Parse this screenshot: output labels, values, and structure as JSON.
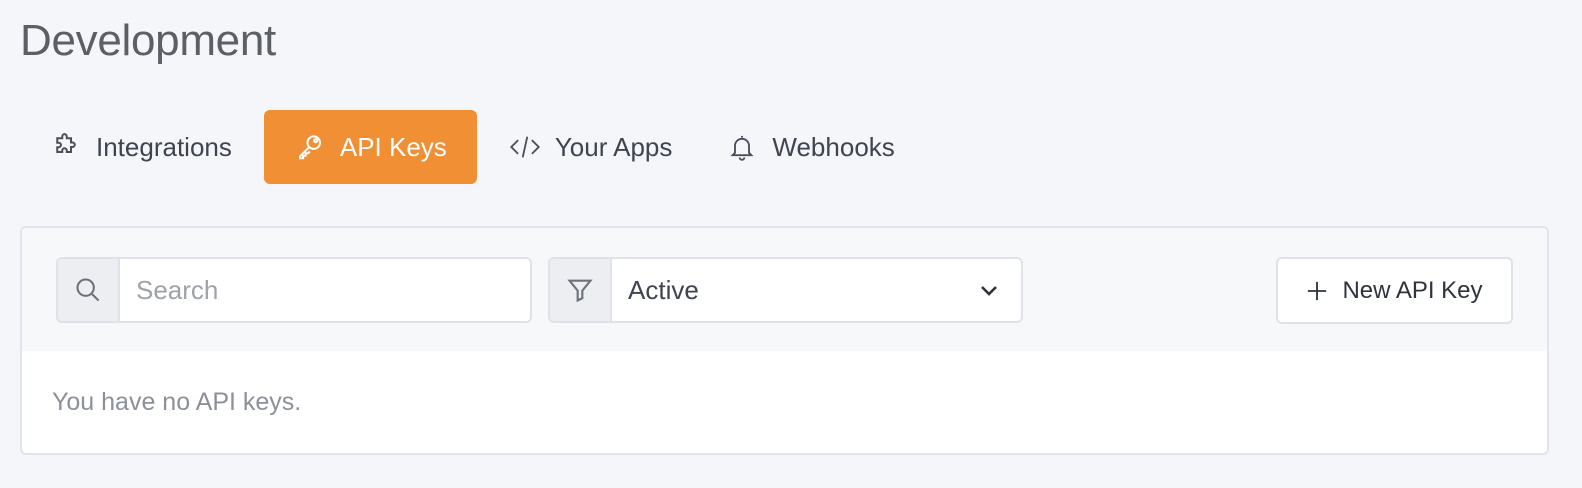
{
  "page": {
    "title": "Development"
  },
  "tabs": [
    {
      "label": "Integrations",
      "icon": "puzzle-icon",
      "active": false
    },
    {
      "label": "API Keys",
      "icon": "key-icon",
      "active": true
    },
    {
      "label": "Your Apps",
      "icon": "code-icon",
      "active": false
    },
    {
      "label": "Webhooks",
      "icon": "bell-icon",
      "active": false
    }
  ],
  "toolbar": {
    "search": {
      "placeholder": "Search",
      "value": ""
    },
    "filter": {
      "selected": "Active"
    },
    "new_key_label": "New API Key"
  },
  "empty_state": {
    "message": "You have no API keys."
  },
  "colors": {
    "accent": "#f08f33",
    "background": "#f5f6f9"
  }
}
